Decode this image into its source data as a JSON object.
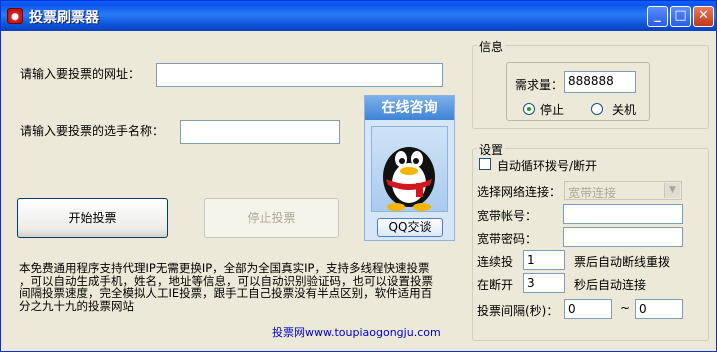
{
  "window": {
    "title": "投票刷票器",
    "minimize_glyph": "_",
    "maximize_glyph": "□",
    "close_glyph": "✕"
  },
  "main": {
    "url_label": "请输入要投票的网址：",
    "url_value": "",
    "name_label": "请输入要投票的选手名称：",
    "name_value": "",
    "start_button": "开始投票",
    "stop_button": "停止投票",
    "description_lines": [
      "本免费通用程序支持代理IP无需更换IP，全部为全国真实IP，支持多线程快速投票",
      "，可以自动生成手机，姓名，地址等信息，可以自动识别验证码，也可以设置投票",
      "间隔投票速度，完全模拟人工IE投票，跟手工自己投票没有半点区别，软件适用百",
      "分之九十九的投票网站"
    ],
    "footer": "投票网www.toupiaogongju.com"
  },
  "qq": {
    "header": "在线咨询",
    "button": "QQ交谈"
  },
  "info": {
    "group_title": "信息",
    "quantity_label": "需求量：",
    "quantity_value": "888888",
    "radio_stop": "停止",
    "radio_shutdown": "关机",
    "selected": "停止"
  },
  "settings": {
    "group_title": "设置",
    "auto_dial_label": "自动循环拨号/断开",
    "auto_dial_checked": false,
    "network_label": "选择网络连接：",
    "network_value": "宽带连接",
    "account_label": "宽带帐号：",
    "account_value": "",
    "password_label": "宽带密码：",
    "password_value": "",
    "row1_prefix": "连续投",
    "row1_value": "1",
    "row1_suffix": "票后自动断线重拨",
    "row2_prefix": "在断开",
    "row2_value": "3",
    "row2_suffix": "秒后自动连接",
    "interval_label": "投票间隔(秒)：",
    "interval_from": "0",
    "interval_sep": "~",
    "interval_to": "0"
  }
}
